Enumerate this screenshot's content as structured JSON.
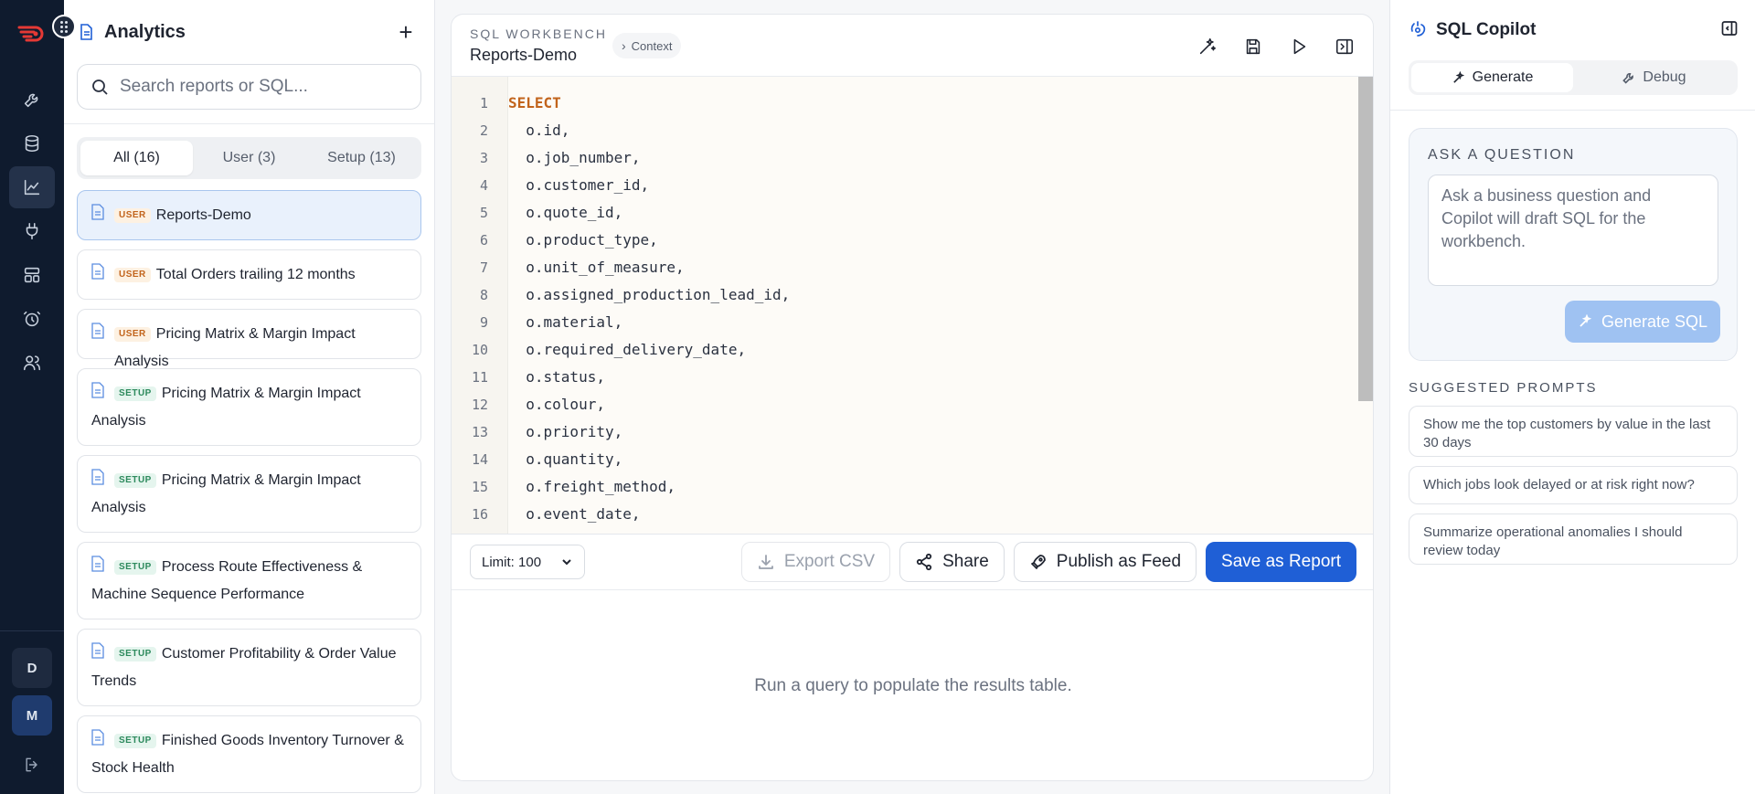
{
  "rail": {
    "items": [
      {
        "icon": "wrench-icon"
      },
      {
        "icon": "database-icon"
      },
      {
        "icon": "chart-icon"
      },
      {
        "icon": "plug-icon"
      },
      {
        "icon": "layout-icon"
      },
      {
        "icon": "alarm-icon"
      },
      {
        "icon": "users-icon"
      }
    ],
    "avatars": [
      "D",
      "M"
    ]
  },
  "sidebar": {
    "title": "Analytics",
    "search_placeholder": "Search reports or SQL...",
    "filters": [
      "All (16)",
      "User (3)",
      "Setup (13)"
    ],
    "reports": [
      {
        "badge": "USER",
        "title": "Reports-Demo"
      },
      {
        "badge": "USER",
        "title": "Total Orders trailing 12 months"
      },
      {
        "badge": "USER",
        "title": "Pricing Matrix & Margin Impact Analysis"
      },
      {
        "badge": "SETUP",
        "title_a": "Pricing Matrix & Margin Impact",
        "title_b": "Analysis"
      },
      {
        "badge": "SETUP",
        "title_a": "Pricing Matrix & Margin Impact",
        "title_b": "Analysis"
      },
      {
        "badge": "SETUP",
        "title_a": "Process Route Effectiveness &",
        "title_b": "Machine Sequence Performance"
      },
      {
        "badge": "SETUP",
        "title_a": "Customer Profitability & Order Value",
        "title_b": "Trends"
      },
      {
        "badge": "SETUP",
        "title_a": "Finished Goods Inventory Turnover &",
        "title_b": "Stock Health"
      }
    ]
  },
  "workbench": {
    "eyebrow": "SQL WORKBENCH",
    "name": "Reports-Demo",
    "context_label": "Context",
    "code": [
      "SELECT",
      "  o.id,",
      "  o.job_number,",
      "  o.customer_id,",
      "  o.quote_id,",
      "  o.product_type,",
      "  o.unit_of_measure,",
      "  o.assigned_production_lead_id,",
      "  o.material,",
      "  o.required_delivery_date,",
      "  o.status,",
      "  o.colour,",
      "  o.priority,",
      "  o.quantity,",
      "  o.freight_method,",
      "  o.event_date,"
    ],
    "limit": "Limit: 100",
    "export_label": "Export CSV",
    "share_label": "Share",
    "publish_label": "Publish as Feed",
    "save_label": "Save as Report",
    "empty_results": "Run a query to populate the results table."
  },
  "copilot": {
    "title": "SQL Copilot",
    "tab_generate": "Generate",
    "tab_debug": "Debug",
    "ask_label": "ASK A QUESTION",
    "ask_placeholder": "Ask a business question and Copilot will draft SQL for the workbench.",
    "generate_button": "Generate SQL",
    "suggested_label": "SUGGESTED PROMPTS",
    "suggestions": [
      "Show me the top customers by value in the last 30 days",
      "Which jobs look delayed or at risk right now?",
      "Summarize operational anomalies I should review today"
    ]
  },
  "colors": {
    "rail_bg": "#0f1b2e",
    "primary": "#1f5fd6",
    "user_badge": "#c2641c",
    "setup_badge": "#2d8a5d",
    "sql_keyword": "#c2641c"
  }
}
